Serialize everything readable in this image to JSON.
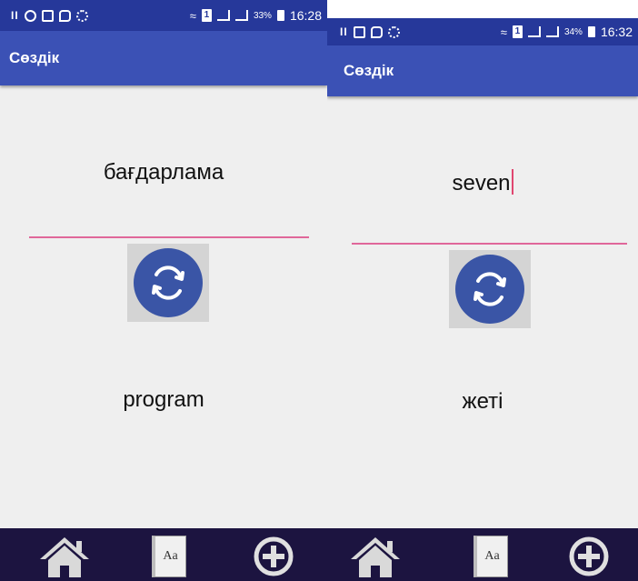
{
  "app": {
    "title": "Сөздік"
  },
  "screens": [
    {
      "status": {
        "battery": "33%",
        "time": "16:28"
      },
      "input_word": "бағдарлама",
      "output_word": "program"
    },
    {
      "status": {
        "battery": "34%",
        "time": "16:32"
      },
      "input_word": "seven",
      "output_word": "жеті"
    }
  ],
  "navbar": {
    "dictionary_icon_text": "Aa"
  },
  "colors": {
    "status_bar": "#26389a",
    "app_bar": "#3b51b5",
    "accent_underline": "#e0679a",
    "swap_button": "#3a55a6",
    "navbar": "#1c1440",
    "background": "#efefef"
  },
  "icons": [
    "pause-icon",
    "whatsapp-icon",
    "gallery-icon",
    "chat-icon",
    "settings-icon",
    "wifi-icon",
    "sim-icon",
    "signal-icon",
    "battery-icon",
    "swap-icon",
    "home-icon",
    "dictionary-icon",
    "add-icon"
  ]
}
